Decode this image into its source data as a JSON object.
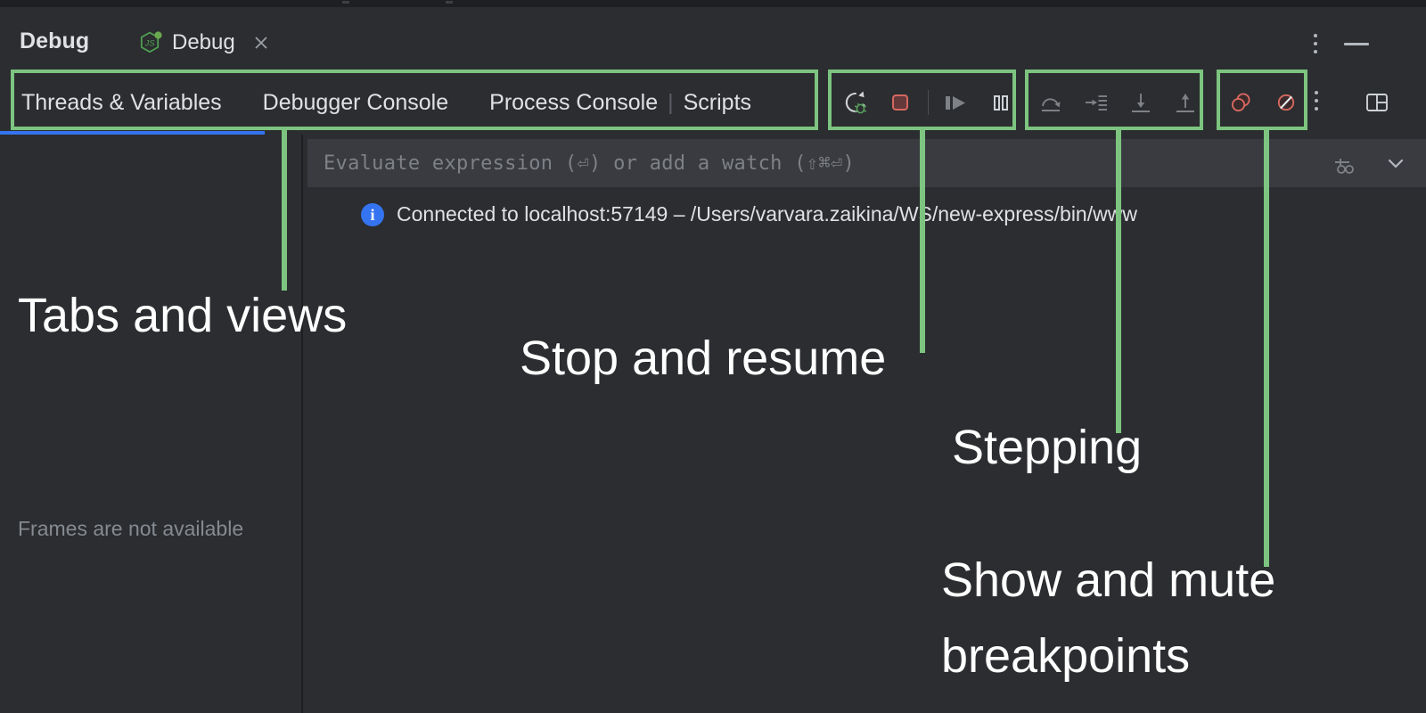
{
  "window": {
    "title": "Debug",
    "run_tab": {
      "label": "Debug",
      "icon": "nodejs-icon",
      "close_icon": "close-icon",
      "running_indicator_color": "#6aa84f"
    },
    "header_more_icon": "more-vertical-icon",
    "header_minimize_icon": "minimize-icon"
  },
  "tabs": [
    {
      "label": "Threads & Variables",
      "active": true
    },
    {
      "label": "Debugger Console",
      "active": false
    },
    {
      "label": "Process Console",
      "active": false
    },
    {
      "separator": "|"
    },
    {
      "label": "Scripts",
      "active": false
    }
  ],
  "toolbar": {
    "stop_resume_group": [
      {
        "name": "rerun-debug-icon",
        "label": "Rerun"
      },
      {
        "name": "stop-icon",
        "label": "Stop",
        "color": "#d6685f"
      },
      {
        "name": "resume-icon",
        "label": "Resume Program"
      },
      {
        "name": "pause-icon",
        "label": "Pause Program"
      }
    ],
    "stepping_group": [
      {
        "name": "step-over-icon",
        "label": "Step Over"
      },
      {
        "name": "step-into-icon",
        "label": "Step Into"
      },
      {
        "name": "force-step-into-icon",
        "label": "Force Step Into"
      },
      {
        "name": "step-out-icon",
        "label": "Step Out"
      }
    ],
    "breakpoints_group": [
      {
        "name": "view-breakpoints-icon",
        "label": "View Breakpoints",
        "color": "#d6685f"
      },
      {
        "name": "mute-breakpoints-icon",
        "label": "Mute Breakpoints",
        "color": "#d6685f"
      }
    ],
    "more_icon": "more-vertical-icon",
    "layout_icon": "layout-settings-icon"
  },
  "evaluate": {
    "placeholder": "Evaluate expression (⏎) or add a watch (⇧⌘⏎)",
    "value": "",
    "add_watch_icon": "add-watch-icon",
    "expand_icon": "chevron-down-icon"
  },
  "console": {
    "icon": "info-icon",
    "icon_glyph": "i",
    "message": "Connected to localhost:57149 – /Users/varvara.zaikina/WS/new-express/bin/www"
  },
  "frames": {
    "empty_message": "Frames are not available"
  },
  "annotations": [
    {
      "id": "tabs-and-views",
      "text": "Tabs and  views"
    },
    {
      "id": "stop-and-resume",
      "text": "Stop and resume"
    },
    {
      "id": "stepping",
      "text": "Stepping"
    },
    {
      "id": "show-and-mute-breakpoints-line1",
      "text": "Show and mute"
    },
    {
      "id": "show-and-mute-breakpoints-line2",
      "text": "breakpoints"
    }
  ],
  "colors": {
    "background": "#2b2d30",
    "panel": "#393b40",
    "accent_blue": "#3574f0",
    "annotation_green": "#7cc47f",
    "text": "#dfe1e5",
    "muted_text": "#868a91",
    "red": "#d6685f"
  }
}
